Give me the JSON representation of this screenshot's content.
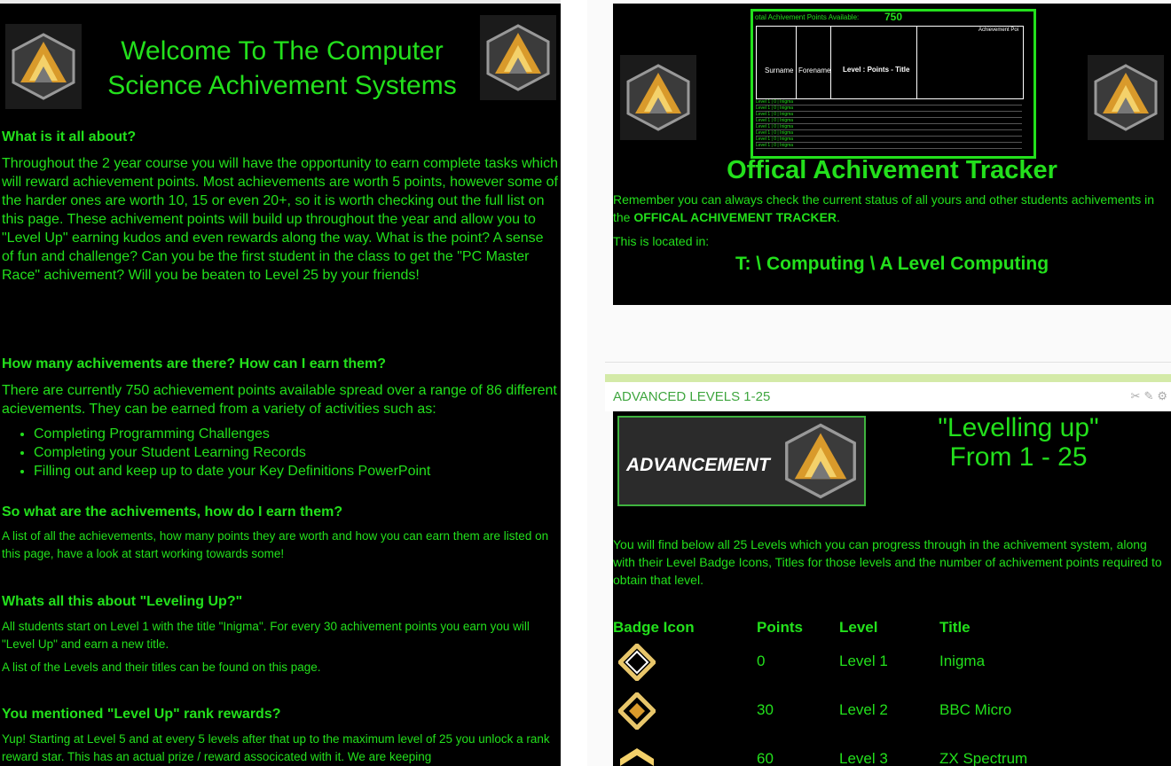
{
  "left": {
    "title": "Welcome To The Computer Science Achivement Systems",
    "sections": [
      {
        "heading": "What is it all about?",
        "paragraphs": [
          "Throughout the 2 year course you will have the opportunity to earn complete tasks which will reward achievement points.  Most achievements are worth 5 points, however some of the harder ones are worth 10, 15 or even 20+, so it is worth checking out the full list on this page.  These achivement points will build up throughout the year and allow you to \"Level Up\" earning kudos and even rewards along the way.  What is the point?  A sense of fun and challenge?  Can you be the first student in the class to get the \"PC Master Race\" achivement?  Will you be beaten to Level 25 by your friends!"
        ]
      },
      {
        "heading": "How many achivements are there? How can I earn them?",
        "paragraphs": [
          "There are currently 750 achievement points available spread over a range of 86 different acievements.  They can be earned from a variety of activities such as:"
        ],
        "list": [
          "Completing Programming Challenges",
          "Completing your Student Learning Records",
          "Filling out and keep up to date your Key Definitions PowerPoint"
        ]
      },
      {
        "heading": "So what are the achivements, how do I earn them?",
        "paragraphs": [
          "A list of all the achievements, how many points they are worth and how you can earn them are listed on this page, have a look at start working towards some!"
        ]
      },
      {
        "heading": "Whats all this about \"Leveling Up?\"",
        "paragraphs": [
          "All students start on Level 1 with the title \"Inigma\".  For every 30 achivement points you earn you will \"Level Up\" and earn a new title.",
          "A list of the Levels and their titles can be found on this page."
        ]
      },
      {
        "heading": "You mentioned \"Level Up\" rank rewards?",
        "paragraphs": [
          "Yup!  Starting at Level 5 and at every 5 levels after that up to the maximum level of 25 you unlock a rank reward star.  This has an actual prize / reward associcated with it.  We are keeping"
        ]
      }
    ]
  },
  "tracker": {
    "sheet_header": "otal Achivement Points Available:",
    "sheet_total": "750",
    "sheet_col_surname": "Surname",
    "sheet_col_forename": "Forename",
    "sheet_col_level": "Level : Points - Title",
    "sheet_section": "Achievement Poi",
    "sheet_row_text": "Level 1  |  0  | Inigma",
    "title": "Offical Achivement Tracker",
    "text1_pre": "Remember you can always check the current status of all yours and other students achivements in the ",
    "text1_bold": "OFFICAL ACHIVEMENT TRACKER",
    "text1_post": ".",
    "text2": "This is located in:",
    "path": "T: \\ Computing \\ A Level Computing"
  },
  "advanced": {
    "header_label": "ADVANCED LEVELS 1-25",
    "banner_text": "ADVANCEMENT",
    "levelling_title": "\"Levelling up\" From 1 - 25",
    "intro": "You will find below all 25 Levels which you can progress through in the achivement system, along with their Level Badge Icons, Titles for those levels and the number of achivement points required to obtain that level.",
    "columns": [
      "Badge Icon",
      "Points",
      "Level",
      "Title"
    ],
    "rows": [
      {
        "points": "0",
        "level": "Level 1",
        "title": "Inigma",
        "badge": "diamond-outline-icon"
      },
      {
        "points": "30",
        "level": "Level 2",
        "title": "BBC Micro",
        "badge": "diamond-gold-icon"
      },
      {
        "points": "60",
        "level": "Level 3",
        "title": "ZX Spectrum",
        "badge": "chevron-gold-icon"
      }
    ]
  },
  "colors": {
    "accent": "#23e01c",
    "panel": "#000000",
    "header_bar": "#d4eaa8"
  }
}
